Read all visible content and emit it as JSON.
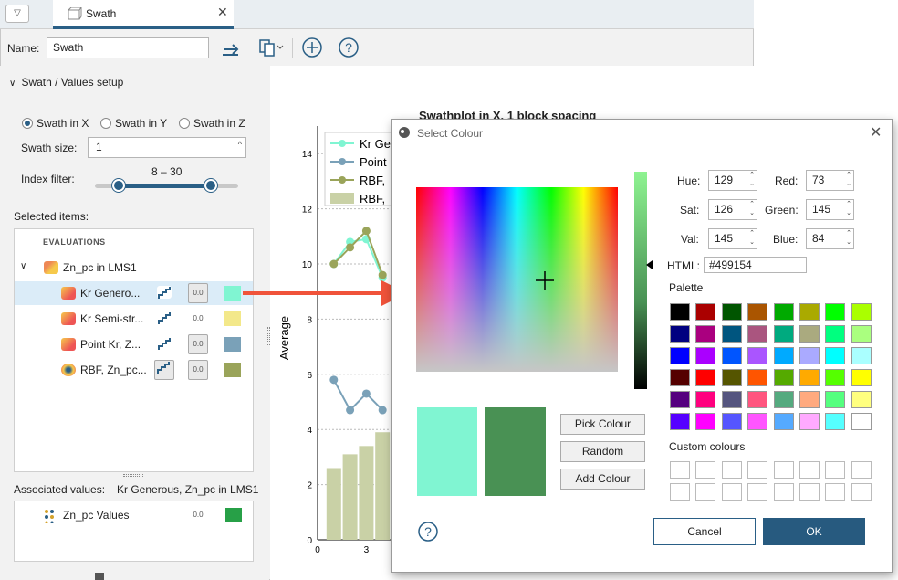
{
  "tab": {
    "title": "Swath",
    "close": "✕"
  },
  "toolbar": {
    "name_label": "Name:",
    "name_value": "Swath"
  },
  "setup": {
    "header": "Swath / Values setup",
    "radio_x": "Swath in X",
    "radio_y": "Swath in Y",
    "radio_z": "Swath in Z",
    "size_label": "Swath size:",
    "size_value": "1",
    "index_label": "Index filter:",
    "index_range": "8 – 30"
  },
  "selected": {
    "label": "Selected items:",
    "group": "EVALUATIONS",
    "parent": "Zn_pc in LMS1",
    "items": [
      {
        "label": "Kr Genero...",
        "color": "#80f5d2"
      },
      {
        "label": "Kr Semi-str...",
        "color": "#f3e88a"
      },
      {
        "label": "Point Kr, Z...",
        "color": "#7aa1b8"
      },
      {
        "label": "RBF, Zn_pc...",
        "color": "#9aa45a"
      }
    ]
  },
  "associated": {
    "label": "Associated values:",
    "value": "Kr Generous, Zn_pc in LMS1",
    "item": "Zn_pc Values",
    "item_color": "#27a047"
  },
  "chart": {
    "title": "Swathplot in X, 1 block spacing",
    "ylabel": "Average",
    "legend": [
      "Kr Ge",
      "Point",
      "RBF,",
      "RBF,"
    ],
    "yticks": [
      "14",
      "12",
      "10",
      "8",
      "6",
      "4",
      "2",
      "0"
    ],
    "xticks": [
      "0",
      "3"
    ]
  },
  "chart_data": {
    "type": "line",
    "series": [
      {
        "name": "Kr Ge",
        "color": "#80f5d2",
        "x": [
          1,
          2,
          3,
          4
        ],
        "y": [
          10,
          10.8,
          10.9,
          9.5
        ]
      },
      {
        "name": "Point",
        "color": "#7aa1b8",
        "x": [
          1,
          2,
          3,
          4
        ],
        "y": [
          5.8,
          4.7,
          5.3,
          4.7
        ]
      },
      {
        "name": "RBF,",
        "color": "#9aa45a",
        "x": [
          1,
          2,
          3,
          4
        ],
        "y": [
          10,
          10.6,
          11.2,
          9.6
        ]
      },
      {
        "name": "RBF,",
        "type": "bar",
        "color": "#c9d1a6",
        "x": [
          1,
          2,
          3,
          4
        ],
        "y": [
          2.6,
          3.1,
          3.4,
          3.9
        ]
      }
    ],
    "ylim": [
      0,
      14
    ]
  },
  "dialog": {
    "title": "Select Colour",
    "hue_label": "Hue:",
    "hue": "129",
    "sat_label": "Sat:",
    "sat": "126",
    "val_label": "Val:",
    "val": "145",
    "red_label": "Red:",
    "red": "73",
    "green_label": "Green:",
    "green": "145",
    "blue_label": "Blue:",
    "blue": "84",
    "html_label": "HTML:",
    "html": "#499154",
    "palette_label": "Palette",
    "custom_label": "Custom colours",
    "pick": "Pick Colour",
    "random": "Random",
    "add": "Add Colour",
    "cancel": "Cancel",
    "ok": "OK",
    "help": "?",
    "old_color": "#80f5d2",
    "new_color": "#499154"
  },
  "palette": [
    "#000000",
    "#aa0000",
    "#005500",
    "#aa5500",
    "#00aa00",
    "#aaaa00",
    "#00ff00",
    "#aaff00",
    "#000080",
    "#aa007f",
    "#00557f",
    "#aa557f",
    "#00aa7f",
    "#aaaa7f",
    "#00ff7f",
    "#aaff7f",
    "#0000ff",
    "#aa00ff",
    "#0055ff",
    "#aa55ff",
    "#00aaff",
    "#aaaaff",
    "#00ffff",
    "#aaffff",
    "#550000",
    "#ff0000",
    "#555500",
    "#ff5500",
    "#55aa00",
    "#ffaa00",
    "#55ff00",
    "#ffff00",
    "#55007f",
    "#ff007f",
    "#55557f",
    "#ff557f",
    "#55aa7f",
    "#ffaa7f",
    "#55ff7f",
    "#ffff7f",
    "#5500ff",
    "#ff00ff",
    "#5555ff",
    "#ff55ff",
    "#55aaff",
    "#ffaaff",
    "#55ffff",
    "#ffffff"
  ]
}
